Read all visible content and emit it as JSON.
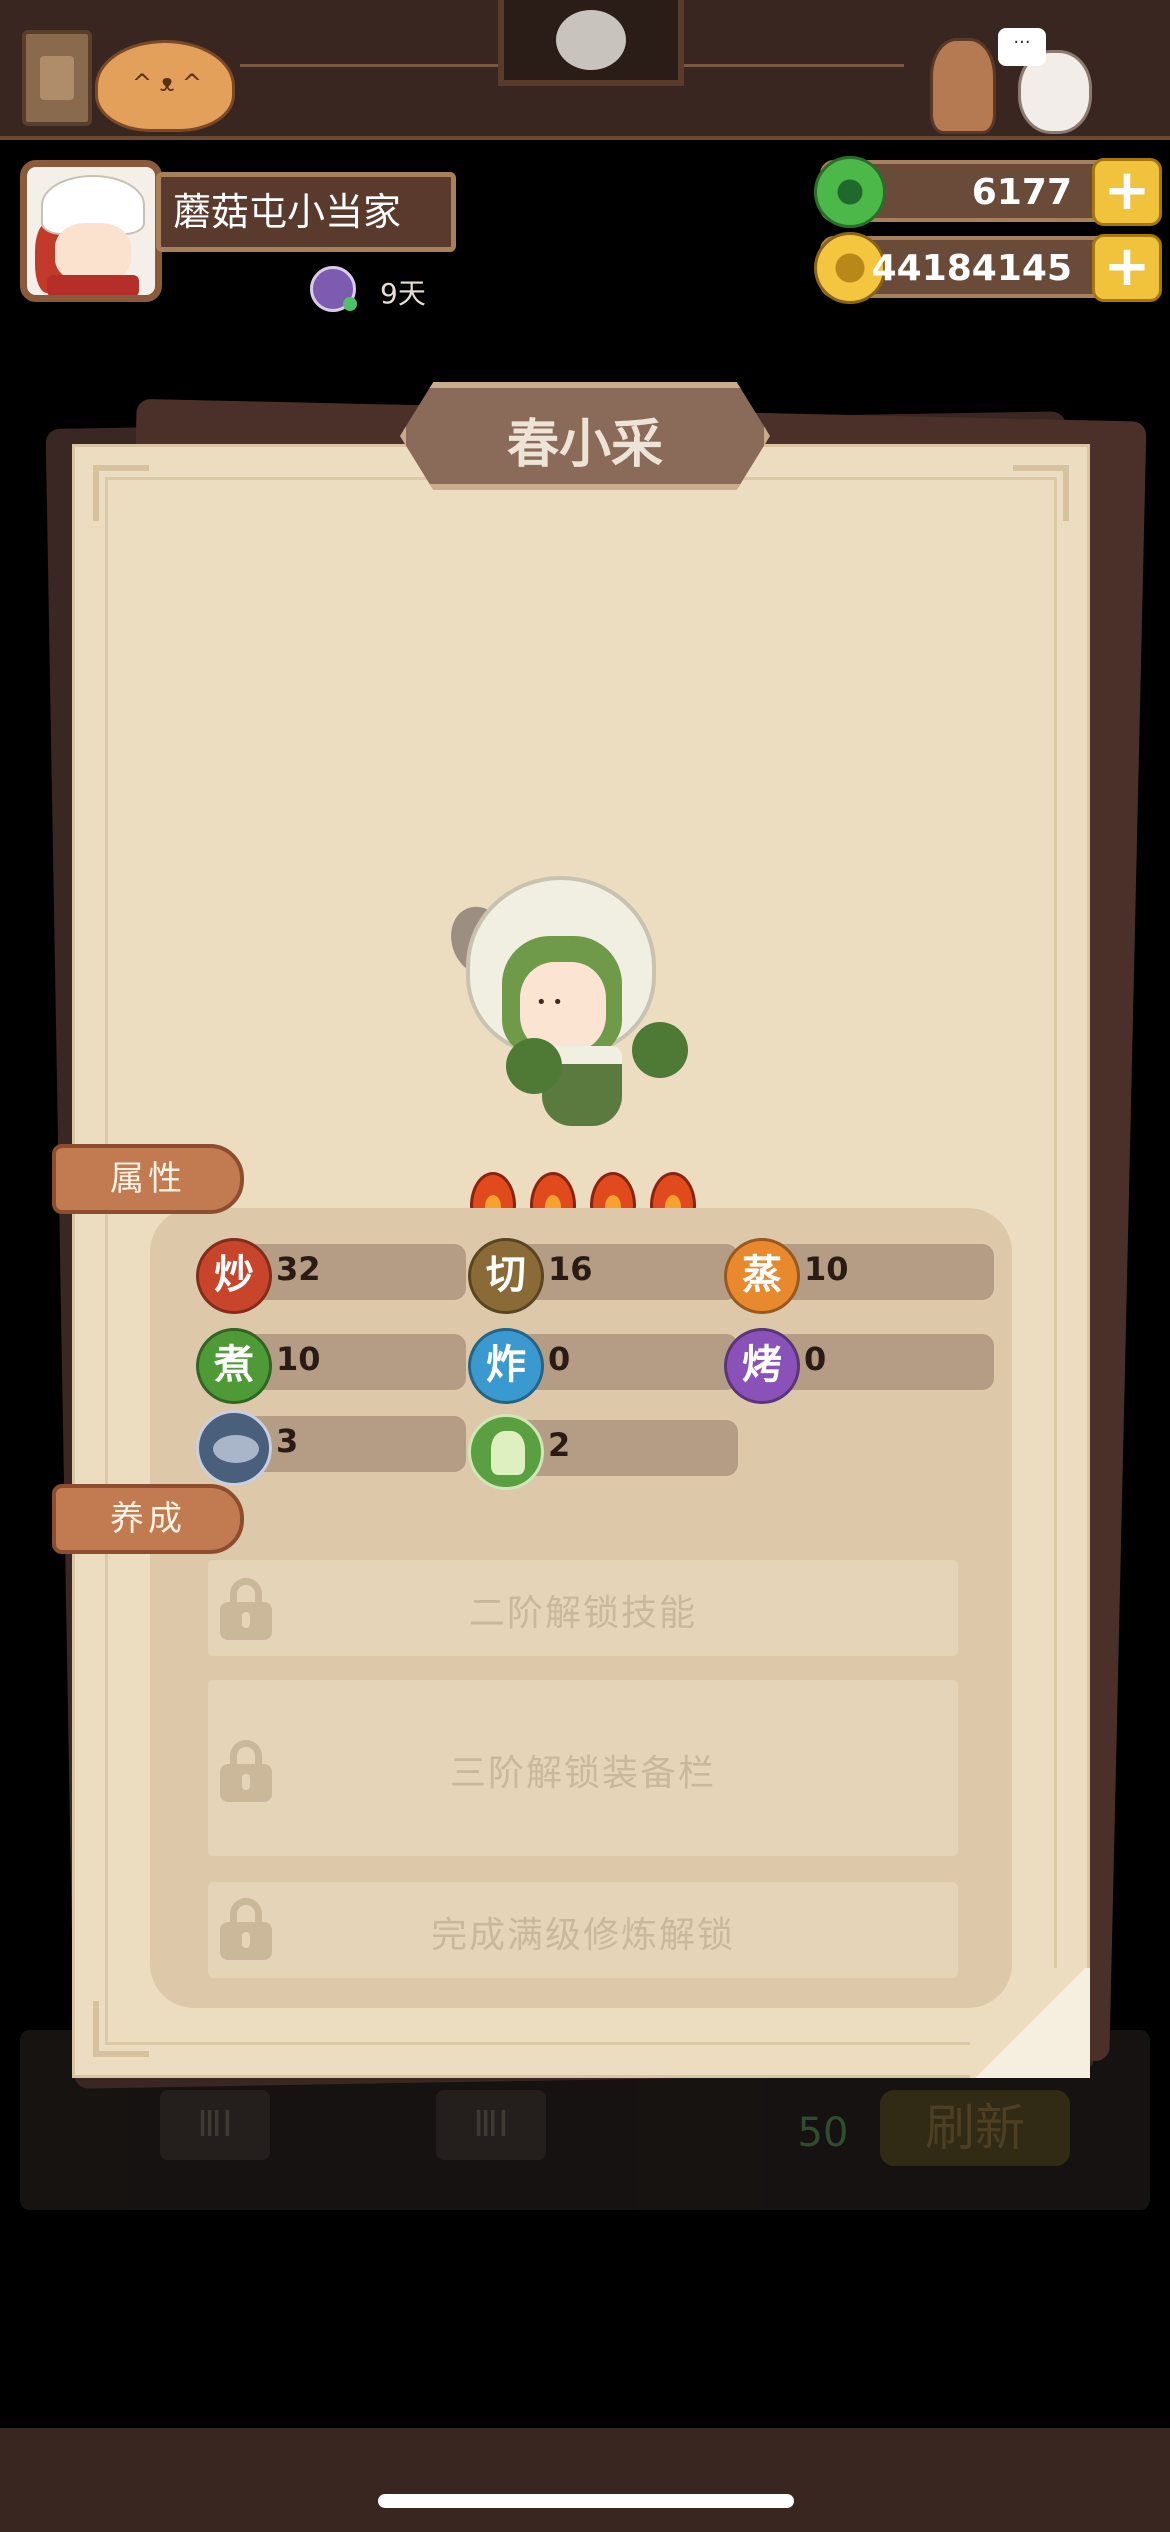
{
  "player": {
    "name": "蘑菇屯小当家",
    "days": "9天"
  },
  "currency": {
    "jade": "6177",
    "coins": "44184145",
    "add_symbol": "+"
  },
  "character": {
    "name": "春小采",
    "stars": 4
  },
  "tabs": {
    "attributes": "属性",
    "training": "养成"
  },
  "stats": [
    {
      "key": "chao",
      "label": "炒",
      "value": "32"
    },
    {
      "key": "qie",
      "label": "切",
      "value": "16"
    },
    {
      "key": "zheng",
      "label": "蒸",
      "value": "10"
    },
    {
      "key": "zhu",
      "label": "煮",
      "value": "10"
    },
    {
      "key": "zha",
      "label": "炸",
      "value": "0"
    },
    {
      "key": "kao",
      "label": "烤",
      "value": "0"
    },
    {
      "key": "fish",
      "label": "",
      "icon": "fish-icon",
      "value": "3"
    },
    {
      "key": "veg",
      "label": "",
      "icon": "cabbage-icon",
      "value": "2"
    }
  ],
  "locked": [
    "二阶解锁技能",
    "三阶解锁装备栏",
    "完成满级修炼解锁"
  ],
  "background": {
    "slot1": "ⅢⅠ",
    "slot2": "ⅢⅠ",
    "cost": "50",
    "refresh": "刷新"
  },
  "colors": {
    "card": "#ecdcc0",
    "tab": "#c27a50",
    "top_bar": "#3a2620"
  }
}
